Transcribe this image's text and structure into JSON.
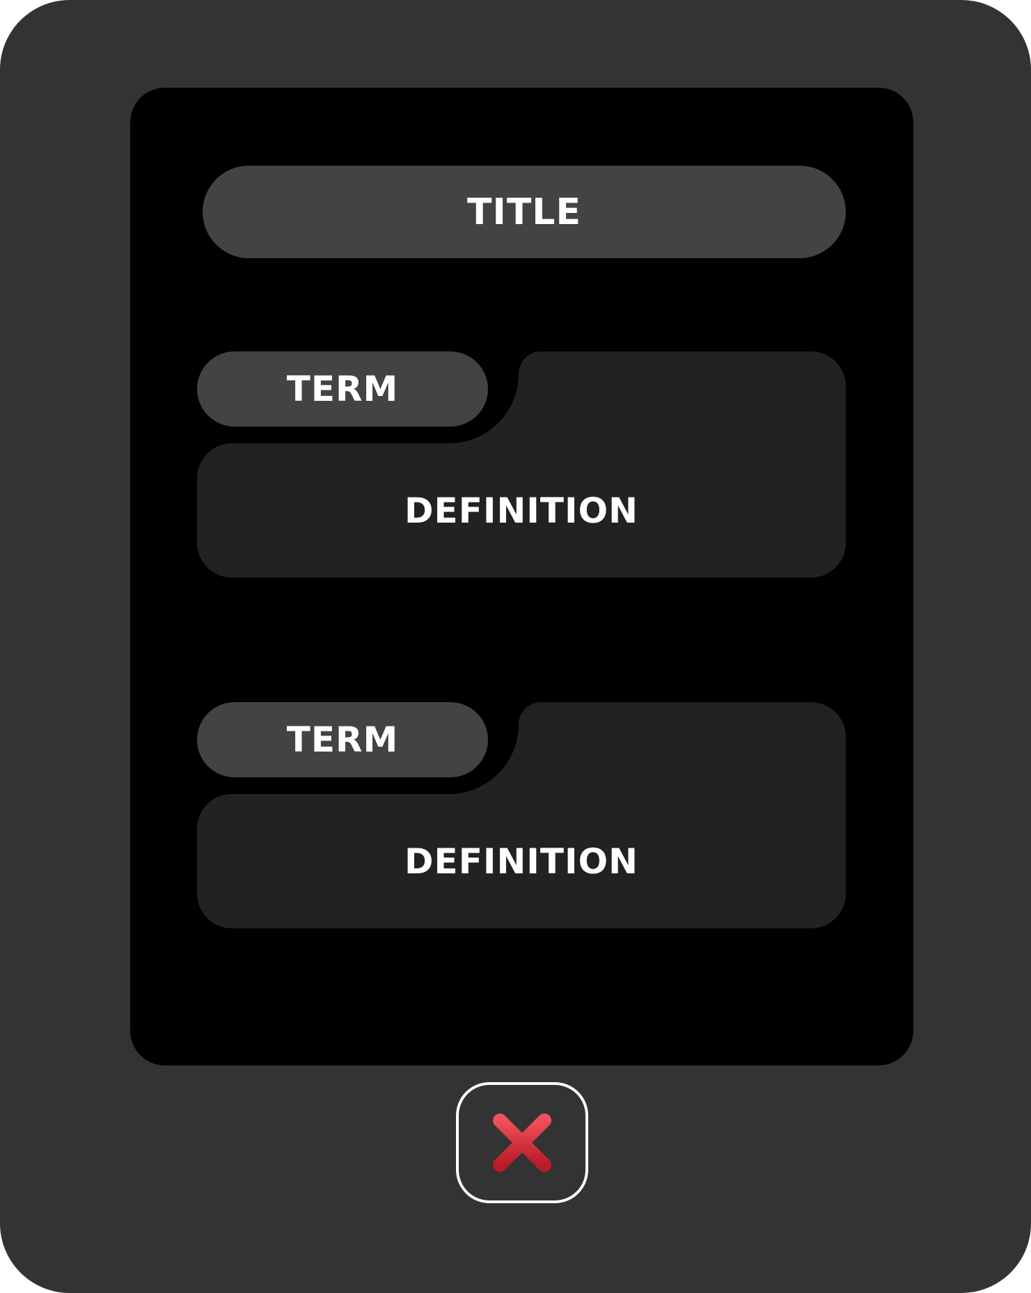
{
  "title": "TITLE",
  "cards": [
    {
      "term": "TERM",
      "definition": "DEFINITION"
    },
    {
      "term": "TERM",
      "definition": "DEFINITION"
    }
  ],
  "close_button": {
    "icon": "close-x-icon"
  },
  "colors": {
    "frame": "#333333",
    "screen": "#000000",
    "pill": "#444244",
    "card": "#222222",
    "close_icon": "#d62a35",
    "text": "#ffffff"
  }
}
